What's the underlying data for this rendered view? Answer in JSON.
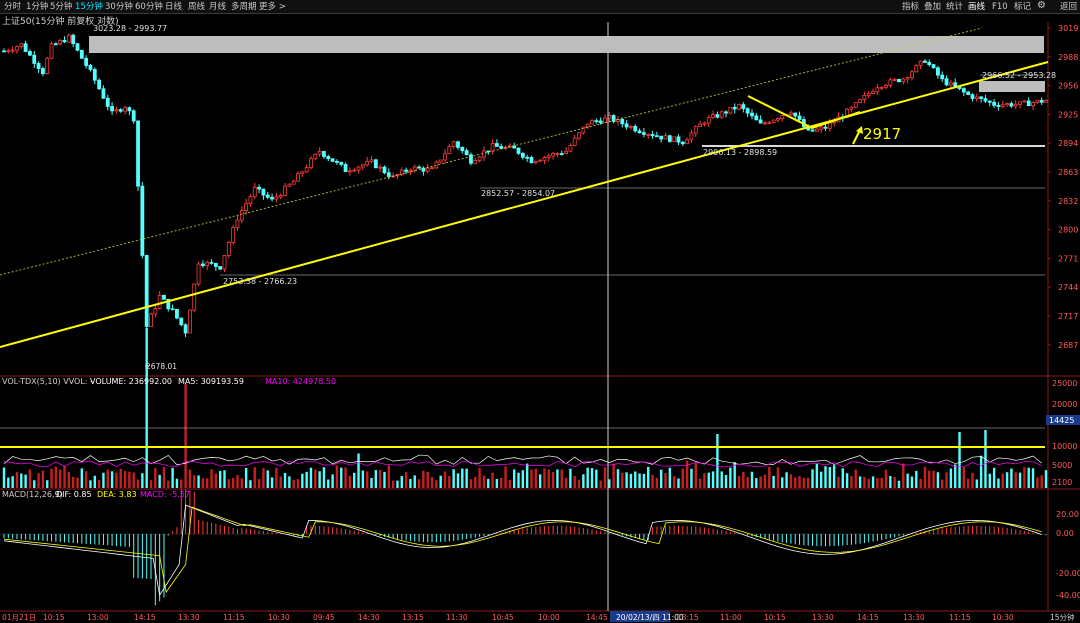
{
  "toolbar": {
    "tabs": [
      "分时",
      "1分钟",
      "5分钟",
      "15分钟",
      "30分钟",
      "60分钟",
      "日线",
      "周线",
      "月线",
      "多周期",
      "更多 >"
    ],
    "active_tab": "15分钟",
    "right": [
      "指标",
      "叠加",
      "统计",
      "画线",
      "F10",
      "标记"
    ],
    "active_right": "画线",
    "gear": "⚙",
    "back": "返回"
  },
  "title": "上证50(15分钟 前复权 对数)",
  "price_axis": {
    "labels": [
      "3019",
      "2988",
      "2956",
      "2925",
      "2894",
      "2863",
      "2832",
      "2800",
      "2771",
      "2744",
      "2717",
      "2687"
    ]
  },
  "volume_panel": {
    "header_name": "VOL-TDX(5,10) VVOL: -",
    "header_volume": "VOLUME: 236992.00",
    "header_ma5": "MA5: 309193.59",
    "header_ma10": "MA10: 424978.50",
    "axis_labels": [
      "25000",
      "20000",
      "14425",
      "10000",
      "5000",
      "2100"
    ],
    "unit_note": "14425"
  },
  "macd_panel": {
    "header_name": "MACD(12,26,9)",
    "header_dif": "DIF: 0.85",
    "header_dea": "DEA: 3.83",
    "header_macd": "MACD: -5.57",
    "axis_labels": [
      "20.00",
      "0.00",
      "-20.00",
      "-40.00"
    ]
  },
  "time_axis": {
    "labels": [
      "01月21日",
      "10:15",
      "13:00",
      "14:15",
      "13:30",
      "11:15",
      "10:30",
      "09:45",
      "14:30",
      "13:15",
      "11:30",
      "10:45",
      "10:00",
      "14:45",
      "20/02/13/四 11:00",
      "13:15",
      "11:00",
      "10:15",
      "13:30",
      "14:15",
      "13:30",
      "11:15",
      "10:30"
    ],
    "period_label": "15分钟"
  },
  "annotations": {
    "top_price": "3023.28 - 2993.77",
    "price_a": "2852.57 - 2854.07",
    "price_b": "2753.38 - 2766.23",
    "price_c": "2906.13 - 2898.59",
    "price_d": "2966.52 - 2953.28",
    "low_label": "2678.01",
    "mark": "2917"
  },
  "colors": {
    "up": "#ff3b3b",
    "down": "#54ffff",
    "trend": "#ffff00",
    "zone": "#bdbdbd",
    "macd_dif": "#ffffff",
    "macd_dea": "#ffff00",
    "ma5": "#ffffff",
    "ma10": "#ff00ff"
  }
}
